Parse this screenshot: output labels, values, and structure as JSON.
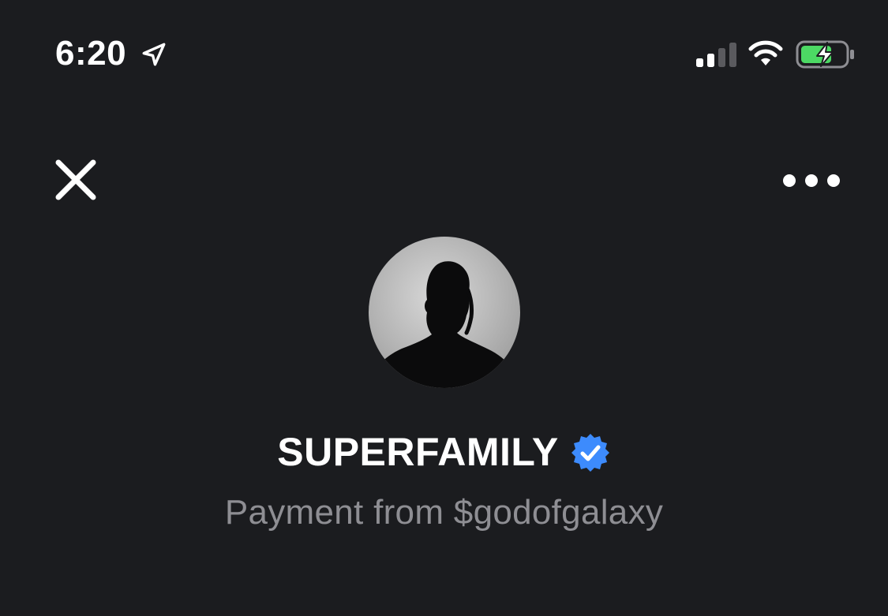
{
  "status_bar": {
    "time": "6:20",
    "icons": [
      "location-arrow-icon",
      "cellular-signal-icon",
      "wifi-icon",
      "battery-charging-icon"
    ],
    "battery_color": "#4cd964"
  },
  "nav": {
    "close_icon": "close-icon",
    "more_icon": "more-options-icon"
  },
  "profile": {
    "avatar_icon": "avatar-silhouette",
    "name": "SUPERFAMILY",
    "verified_icon": "verified-badge-icon",
    "verified_color": "#3d8bfd",
    "subtitle": "Payment from $godofgalaxy"
  },
  "colors": {
    "background": "#1b1c1f",
    "primary_text": "#ffffff",
    "secondary_text": "#8e8e93"
  }
}
